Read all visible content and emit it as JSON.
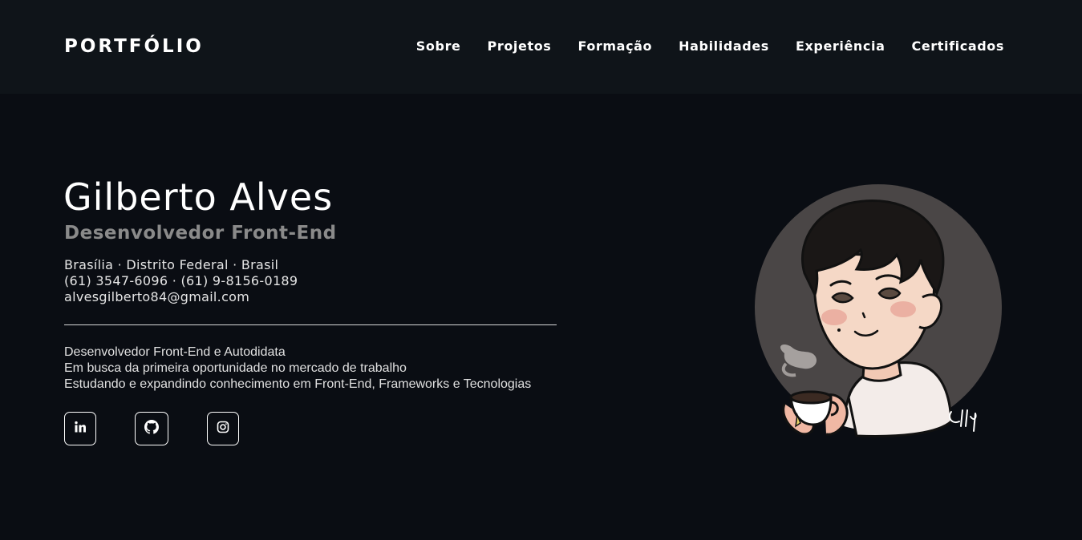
{
  "header": {
    "brand": "PORTFÓLIO",
    "nav": [
      "Sobre",
      "Projetos",
      "Formação",
      "Habilidades",
      "Experiência",
      "Certificados"
    ]
  },
  "hero": {
    "name": "Gilberto Alves",
    "role": "Desenvolvedor Front-End",
    "location": "Brasília · Distrito Federal · Brasil",
    "phones": "(61) 3547-6096 · (61) 9-8156-0189",
    "email": "alvesgilberto84@gmail.com",
    "bio": [
      "Desenvolvedor Front-End e Autodidata",
      "Em busca da primeira oportunidade no mercado de trabalho",
      "Estudando e expandindo conhecimento em Front-End, Frameworks e Tecnologias"
    ],
    "social": [
      {
        "icon": "linkedin-icon"
      },
      {
        "icon": "github-icon"
      },
      {
        "icon": "instagram-icon"
      }
    ],
    "avatar": {
      "icon": "avatar-illustration",
      "signature": "Lolly"
    }
  },
  "colors": {
    "background": "#0a0d13",
    "header": "#0f1419",
    "role": "#8a8a8a",
    "avatar_circle": "#4a4646"
  }
}
